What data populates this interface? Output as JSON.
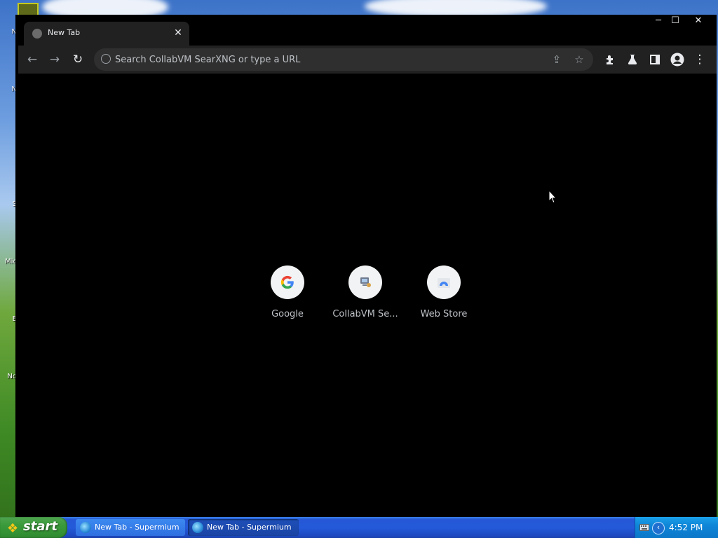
{
  "browser": {
    "tab": {
      "title": "New Tab"
    },
    "window_controls": {
      "minimize": "─",
      "maximize": "☐",
      "close": "✕"
    },
    "omnibox": {
      "placeholder": "Search CollabVM SearXNG or type a URL"
    },
    "shortcuts": [
      {
        "label": "Google",
        "icon": "google-icon"
      },
      {
        "label": "CollabVM Se...",
        "icon": "collabvm-icon"
      },
      {
        "label": "Web Store",
        "icon": "webstore-icon"
      }
    ]
  },
  "taskbar": {
    "start_label": "start",
    "tasks": [
      {
        "label": "New Tab - Supermium",
        "active": false
      },
      {
        "label": "New Tab - Supermium",
        "active": true
      }
    ],
    "clock": "4:52 PM"
  },
  "colors": {
    "browser_bg": "#000000",
    "toolbar_bg": "#212121",
    "omnibox_bg": "#2f2f2f",
    "taskbar_blue": "#245ad9",
    "start_green": "#3a9a3a"
  }
}
